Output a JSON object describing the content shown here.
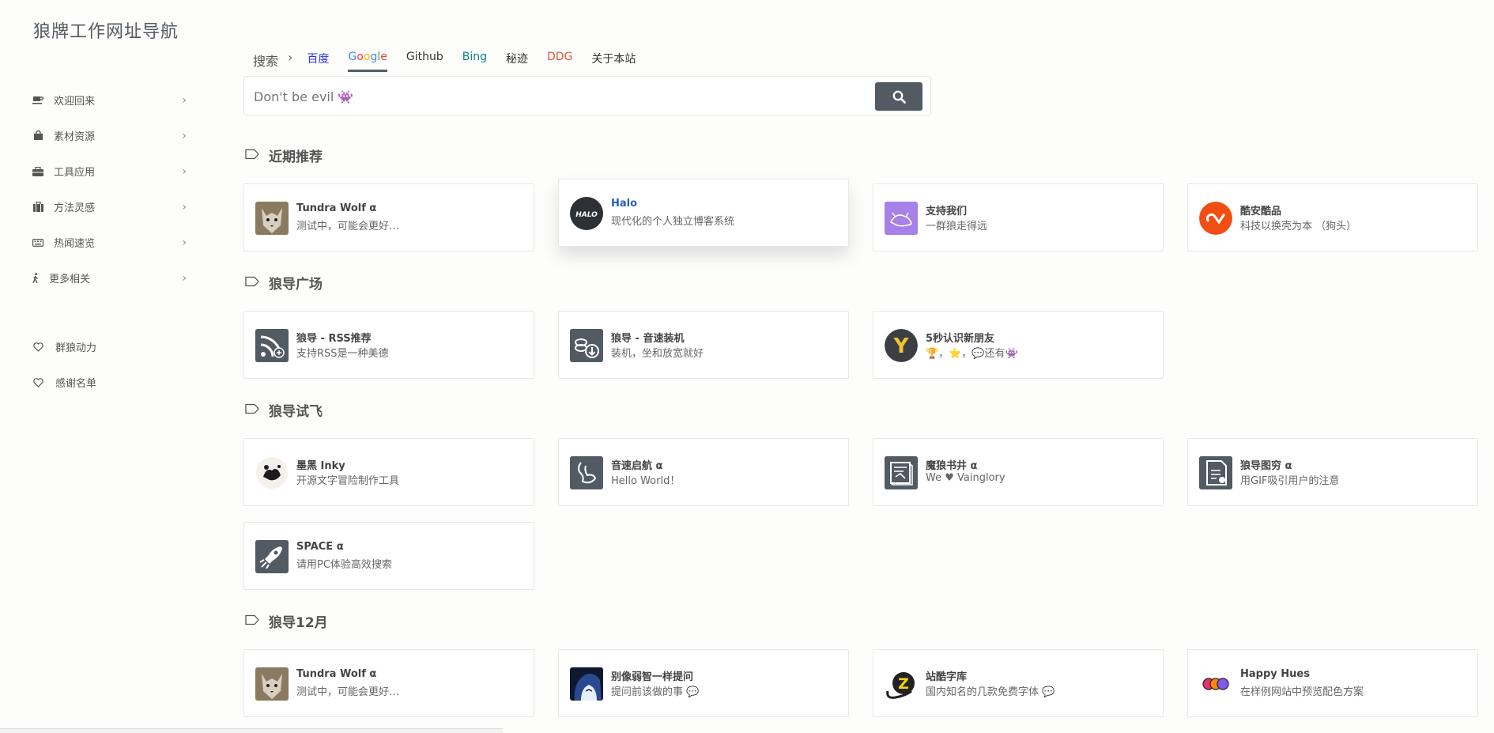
{
  "site": {
    "title": "狼牌工作网址导航"
  },
  "sidebar": {
    "items": [
      {
        "label": "欢迎回来",
        "icon": "coffee-icon"
      },
      {
        "label": "素材资源",
        "icon": "shopping-bag-icon"
      },
      {
        "label": "工具应用",
        "icon": "toolbox-icon"
      },
      {
        "label": "方法灵感",
        "icon": "suitcase-icon"
      },
      {
        "label": "热闻速览",
        "icon": "keyboard-icon"
      },
      {
        "label": "更多相关",
        "icon": "walking-icon"
      }
    ],
    "extra": [
      {
        "label": "群狼动力",
        "icon": "heart-icon"
      },
      {
        "label": "感谢名单",
        "icon": "heart-icon"
      }
    ]
  },
  "search": {
    "label": "搜索",
    "separator": "›",
    "tabs": [
      {
        "label": "百度",
        "color": "#2932e1"
      },
      {
        "label": "Google",
        "color": "google"
      },
      {
        "label": "Github",
        "color": "#333333"
      },
      {
        "label": "Bing",
        "color": "#0c8484"
      },
      {
        "label": "秘迹",
        "color": "#333333"
      },
      {
        "label": "DDG",
        "color": "#de5833"
      },
      {
        "label": "关于本站",
        "color": "#333333"
      }
    ],
    "active_tab": "Google",
    "placeholder": "Don't be evil 👾"
  },
  "sections": [
    {
      "title": "近期推荐",
      "cards": [
        {
          "title": "Tundra Wolf α",
          "desc": "测试中，可能会更好…",
          "icon": "wolf-avatar"
        },
        {
          "title": "Halo",
          "desc": "现代化的个人独立博客系统",
          "icon": "halo-logo"
        },
        {
          "title": "支持我们",
          "desc": "一群狼走得远",
          "icon": "wolf-sketch-icon"
        },
        {
          "title": "酷安酷品",
          "desc": "科技以换壳为本 （狗头）",
          "icon": "coolapk-logo"
        }
      ]
    },
    {
      "title": "狼导广场",
      "cards": [
        {
          "title": "狼导 - RSS推荐",
          "desc": "支持RSS是一种美德",
          "icon": "rss-icon"
        },
        {
          "title": "狼导 - 音速装机",
          "desc": "装机，坐和放宽就好",
          "icon": "download-icon"
        },
        {
          "title": "5秒认识新朋友",
          "desc": "🏆，⭐，💬还有👾",
          "icon": "y-logo"
        }
      ]
    },
    {
      "title": "狼导试飞",
      "cards": [
        {
          "title": "墨黑 Inky",
          "desc": "开源文字冒险制作工具",
          "icon": "inky-logo"
        },
        {
          "title": "音速启航 α",
          "desc": "Hello World！",
          "icon": "swan-icon"
        },
        {
          "title": "魔狼书井 α",
          "desc": "We ♥ Vainglory",
          "icon": "book-icon"
        },
        {
          "title": "狼导图穷 α",
          "desc": "用GIF吸引用户的注意",
          "icon": "gif-icon"
        },
        {
          "title": "SPACE α",
          "desc": "请用PC体验高效搜索",
          "icon": "rocket-icon"
        }
      ]
    },
    {
      "title": "狼导12月",
      "cards": [
        {
          "title": "Tundra Wolf α",
          "desc": "测试中，可能会更好…",
          "icon": "wolf-avatar"
        },
        {
          "title": "别像弱智一样提问",
          "desc": "提问前该做的事 💬",
          "icon": "anime-avatar"
        },
        {
          "title": "站酷字库",
          "desc": "国内知名的几款免费字体 💬",
          "icon": "zcool-logo"
        },
        {
          "title": "Happy Hues",
          "desc": "在样例网站中预览配色方案",
          "icon": "palette-icon"
        }
      ]
    }
  ],
  "colors": {
    "accent": "#525a64",
    "halo_title": "#2460b8"
  }
}
